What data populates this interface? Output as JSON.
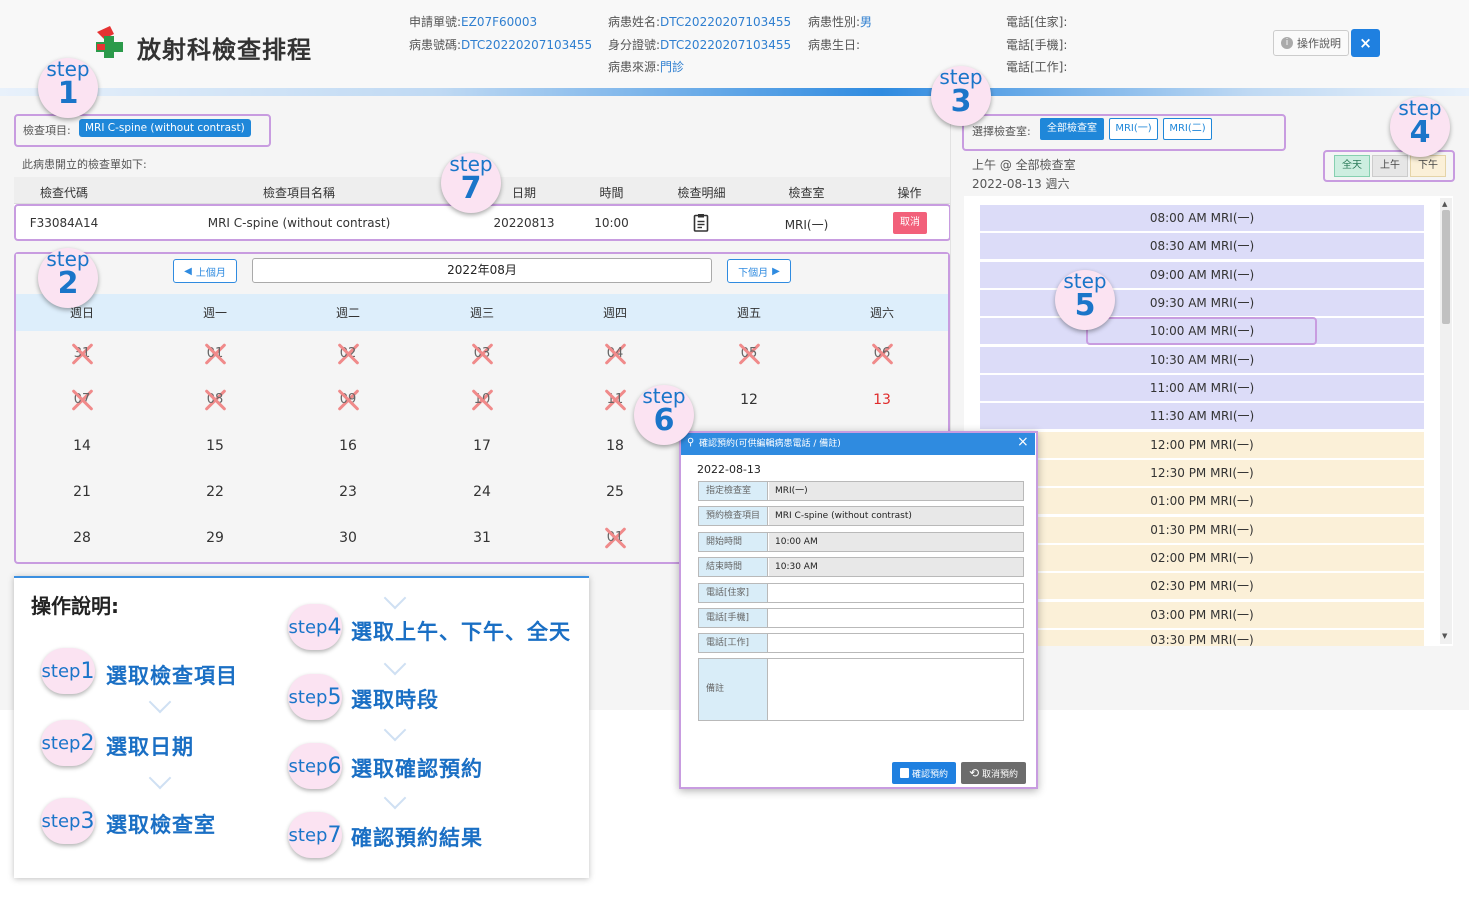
{
  "app": {
    "title": "放射科檢查排程"
  },
  "patient": {
    "order_no_label": "申請單號:",
    "order_no": "EZ07F60003",
    "chart_no_label": "病患號碼:",
    "chart_no": "DTC20220207103455",
    "name_label": "病患姓名:",
    "name": "DTC20220207103455",
    "id_label": "身分證號:",
    "id_no": "DTC20220207103455",
    "source_label": "病患來源:",
    "source": "門診",
    "sex_label": "病患性別:",
    "sex": "男",
    "birth_label": "病患生日:",
    "birth": "",
    "tel_home_label": "電話[住家]:",
    "tel_mobile_label": "電話[手機]:",
    "tel_work_label": "電話[工作]:"
  },
  "header_buttons": {
    "help": "操作說明",
    "close": "×"
  },
  "exam_item": {
    "label": "檢查項目:",
    "value": "MRI C-spine (without contrast)"
  },
  "orders": {
    "caption": "此病患開立的檢查單如下:",
    "columns": [
      "檢查代碼",
      "檢查項目名稱",
      "日期",
      "時間",
      "檢查明細",
      "檢查室",
      "操作"
    ],
    "rows": [
      {
        "code": "F33084A14",
        "name": "MRI C-spine (without contrast)",
        "date": "20220813",
        "time": "10:00",
        "room": "MRI(一)",
        "action": "取消"
      }
    ]
  },
  "calendar": {
    "prev": "上個月",
    "next": "下個月",
    "month": "2022年08月",
    "weekdays": [
      "週日",
      "週一",
      "週二",
      "週三",
      "週四",
      "週五",
      "週六"
    ],
    "disabled": [
      "31",
      "01",
      "02",
      "03",
      "04",
      "05",
      "06",
      "07",
      "08",
      "09",
      "10",
      "11",
      "01"
    ],
    "days": [
      "12",
      "13",
      "14",
      "15",
      "16",
      "17",
      "18",
      "21",
      "22",
      "23",
      "24",
      "25",
      "28",
      "29",
      "30",
      "31"
    ]
  },
  "rooms": {
    "label": "選擇檢查室:",
    "options": [
      "全部檢查室",
      "MRI(一)",
      "MRI(二)"
    ]
  },
  "schedule": {
    "summary": "上午 @ 全部檢查室",
    "date": "2022-08-13 週六",
    "filters": [
      "全天",
      "上午",
      "下午"
    ],
    "am_slots": [
      "08:00 AM MRI(一)",
      "08:30 AM MRI(一)",
      "09:00 AM MRI(一)",
      "09:30 AM MRI(一)",
      "10:00 AM MRI(一)",
      "10:30 AM MRI(一)",
      "11:00 AM MRI(一)",
      "11:30 AM MRI(一)"
    ],
    "pm_slots": [
      "12:00 PM MRI(一)",
      "12:30 PM MRI(一)",
      "01:00 PM MRI(一)",
      "01:30 PM MRI(一)",
      "02:00 PM MRI(一)",
      "02:30 PM MRI(一)",
      "03:00 PM MRI(一)",
      "03:30 PM MRI(一)"
    ]
  },
  "modal": {
    "title": "確認預約(可供編輯病患電話 / 備註)",
    "date": "2022-08-13",
    "fields": [
      {
        "label": "指定檢查室",
        "value": "MRI(一)"
      },
      {
        "label": "預約檢查項目",
        "value": "MRI C-spine (without contrast)"
      },
      {
        "label": "開始時間",
        "value": "10:00 AM"
      },
      {
        "label": "結束時間",
        "value": "10:30 AM"
      },
      {
        "label": "電話[住家]",
        "value": ""
      },
      {
        "label": "電話[手機]",
        "value": ""
      },
      {
        "label": "電話[工作]",
        "value": ""
      },
      {
        "label": "備註",
        "value": ""
      }
    ],
    "confirm": "確認預約",
    "cancel": "取消預約"
  },
  "steps": {
    "word": "step",
    "nums": [
      "1",
      "2",
      "3",
      "4",
      "5",
      "6",
      "7"
    ]
  },
  "explain": {
    "title": "操作說明:",
    "items": [
      {
        "step": "step",
        "num": "1",
        "text": "選取檢查項目"
      },
      {
        "step": "step",
        "num": "2",
        "text": "選取日期"
      },
      {
        "step": "step",
        "num": "3",
        "text": "選取檢查室"
      },
      {
        "step": "step",
        "num": "4",
        "text": "選取上午、下午、全天"
      },
      {
        "step": "step",
        "num": "5",
        "text": "選取時段"
      },
      {
        "step": "step",
        "num": "6",
        "text": "選取確認預約"
      },
      {
        "step": "step",
        "num": "7",
        "text": "確認預約結果"
      }
    ]
  },
  "colors": {
    "accent": "#1f80e0",
    "highlight": "#c89ce0",
    "bubble": "#fbe3f2",
    "am": "#dcdcf8",
    "pm": "#fbf0d8",
    "danger": "#f2607a"
  }
}
